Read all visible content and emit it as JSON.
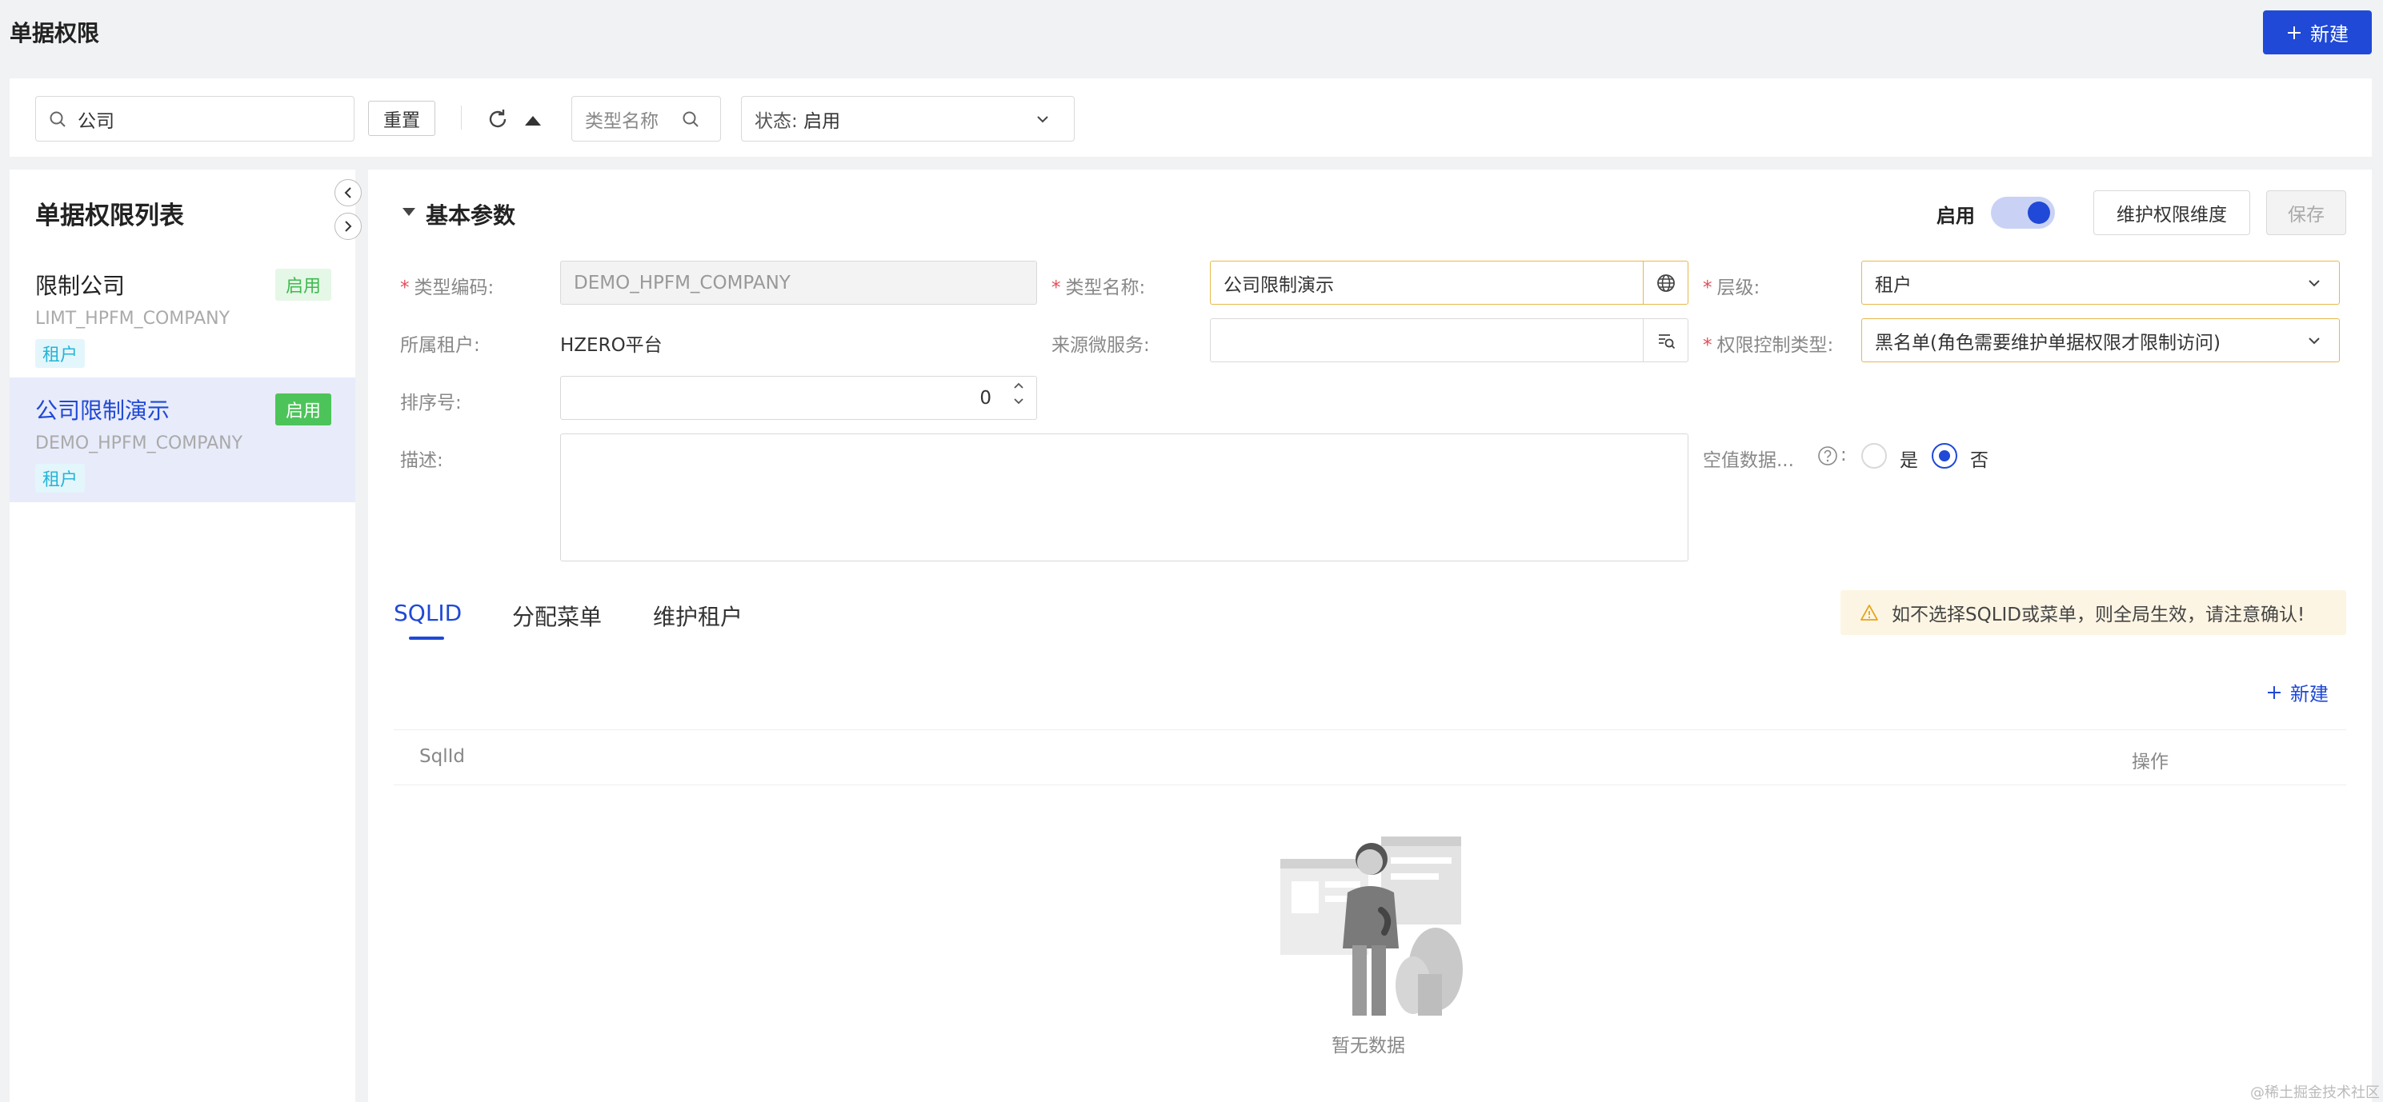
{
  "header": {
    "title": "单据权限",
    "new_button": "新建"
  },
  "filter": {
    "search_value": "公司",
    "reset_label": "重置",
    "type_name_placeholder": "类型名称",
    "status_label": "状态:",
    "status_value": "启用"
  },
  "list": {
    "title": "单据权限列表",
    "items": [
      {
        "name": "限制公司",
        "code": "LIMT_HPFM_COMPANY",
        "status": "启用",
        "tag": "租户"
      },
      {
        "name": "公司限制演示",
        "code": "DEMO_HPFM_COMPANY",
        "status": "启用",
        "tag": "租户"
      }
    ]
  },
  "main": {
    "section_title": "基本参数",
    "enable_label": "启用",
    "enabled": true,
    "maintain_button": "维护权限维度",
    "save_button": "保存",
    "form": {
      "type_code_label": "类型编码",
      "type_code_value": "DEMO_HPFM_COMPANY",
      "type_name_label": "类型名称",
      "type_name_value": "公司限制演示",
      "level_label": "层级",
      "level_value": "租户",
      "tenant_label": "所属租户",
      "tenant_value": "HZERO平台",
      "service_label": "来源微服务",
      "service_value": "",
      "control_type_label": "权限控制类型",
      "control_type_value": "黑名单(角色需要维护单据权限才限制访问)",
      "order_label": "排序号",
      "order_value": "0",
      "desc_label": "描述",
      "desc_value": "",
      "null_data_label": "空值数据...",
      "yes_label": "是",
      "no_label": "否",
      "colon": ":"
    },
    "tabs": [
      "SQLID",
      "分配菜单",
      "维护租户"
    ],
    "warning": "如不选择SQLID或菜单，则全局生效，请注意确认!",
    "table_new_button": "新建",
    "table_columns": [
      "SqlId",
      "操作"
    ],
    "empty_text": "暂无数据"
  },
  "watermark": "@稀土掘金技术社区",
  "colors": {
    "primary": "#1f49d6",
    "success": "#4cc45a",
    "warning_bg": "#fdf5e3",
    "required": "#e34d59"
  }
}
